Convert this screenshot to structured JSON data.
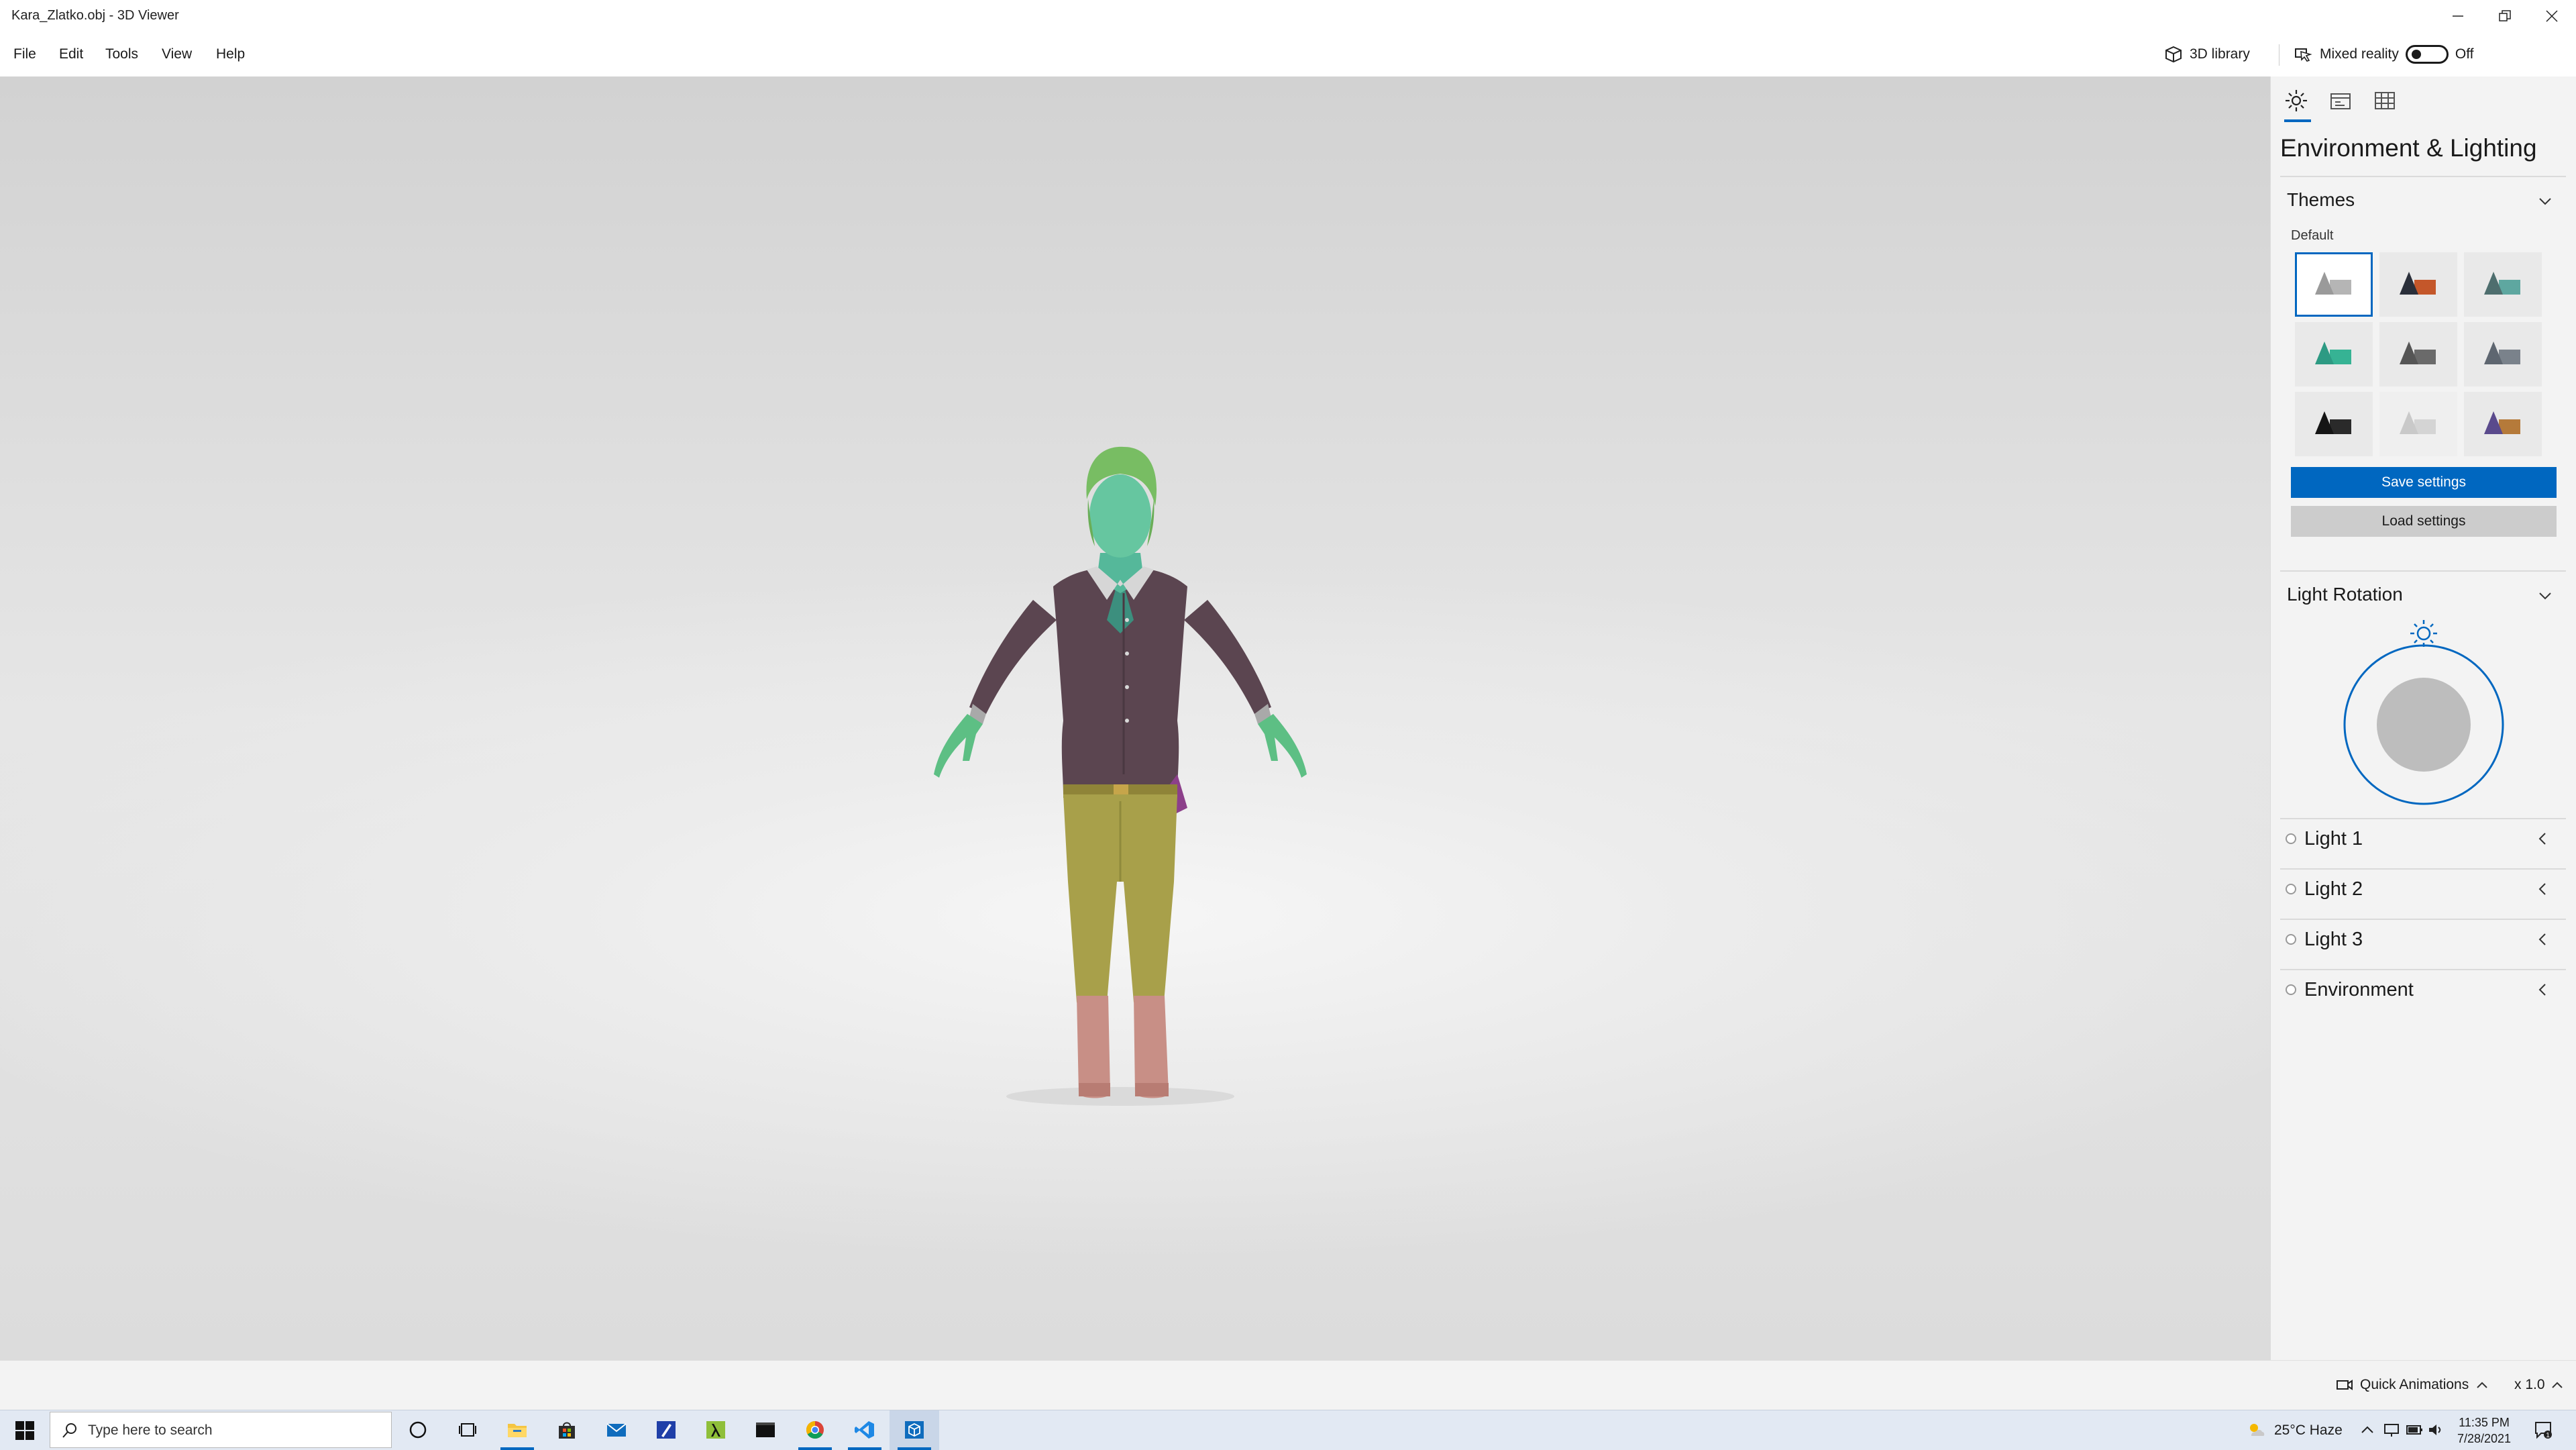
{
  "window": {
    "title": "Kara_Zlatko.obj - 3D Viewer"
  },
  "menu": {
    "items": [
      "File",
      "Edit",
      "Tools",
      "View",
      "Help"
    ]
  },
  "top_actions": {
    "library_label": "3D library",
    "mixed_reality_label": "Mixed reality",
    "mixed_reality_state": "Off"
  },
  "panel": {
    "title": "Environment & Lighting",
    "tabs": [
      "lighting-icon",
      "stats-icon",
      "grid-icon"
    ],
    "themes": {
      "heading": "Themes",
      "current": "Default",
      "tiles": [
        {
          "name": "default",
          "shape": "#9a9a9a",
          "accent": "#b5b5b5",
          "bg": "#ffffff"
        },
        {
          "name": "copper",
          "shape": "#2a2f3a",
          "accent": "#c4572a",
          "bg": "#e9e9e9"
        },
        {
          "name": "teal-steel",
          "shape": "#4e6e6e",
          "accent": "#5ea7a0",
          "bg": "#e9e9e9"
        },
        {
          "name": "aqua",
          "shape": "#2d9a83",
          "accent": "#36b394",
          "bg": "#e9e9e9"
        },
        {
          "name": "graphite",
          "shape": "#555555",
          "accent": "#6a6a6a",
          "bg": "#e9e9e9"
        },
        {
          "name": "slate",
          "shape": "#5e6670",
          "accent": "#7a828b",
          "bg": "#e9e9e9"
        },
        {
          "name": "black",
          "shape": "#151515",
          "accent": "#2a2a2a",
          "bg": "#e9e9e9"
        },
        {
          "name": "light",
          "shape": "#c9c9c9",
          "accent": "#d4d4d4",
          "bg": "#efefef"
        },
        {
          "name": "purple-bronze",
          "shape": "#5a4a8c",
          "accent": "#b57a3a",
          "bg": "#e9e9e9"
        }
      ],
      "save_label": "Save settings",
      "load_label": "Load settings"
    },
    "light_rotation": {
      "heading": "Light Rotation"
    },
    "lights": [
      {
        "label": "Light 1"
      },
      {
        "label": "Light 2"
      },
      {
        "label": "Light 3"
      },
      {
        "label": "Environment"
      }
    ]
  },
  "status": {
    "quick_animations_label": "Quick Animations",
    "speed_label": "x 1.0"
  },
  "taskbar": {
    "search_placeholder": "Type here to search",
    "weather": "25°C  Haze",
    "time": "11:35 PM",
    "date": "7/28/2021",
    "apps": [
      "cortana-icon",
      "task-view-icon",
      "file-explorer-icon",
      "store-icon",
      "mail-icon",
      "pen-app-icon",
      "lambda-app-icon",
      "terminal-icon",
      "chrome-icon",
      "vscode-icon",
      "3d-viewer-icon"
    ]
  },
  "colors": {
    "accent": "#0067c0",
    "panel_bg": "#f3f3f3",
    "taskbar_bg": "#e2e9f3"
  }
}
